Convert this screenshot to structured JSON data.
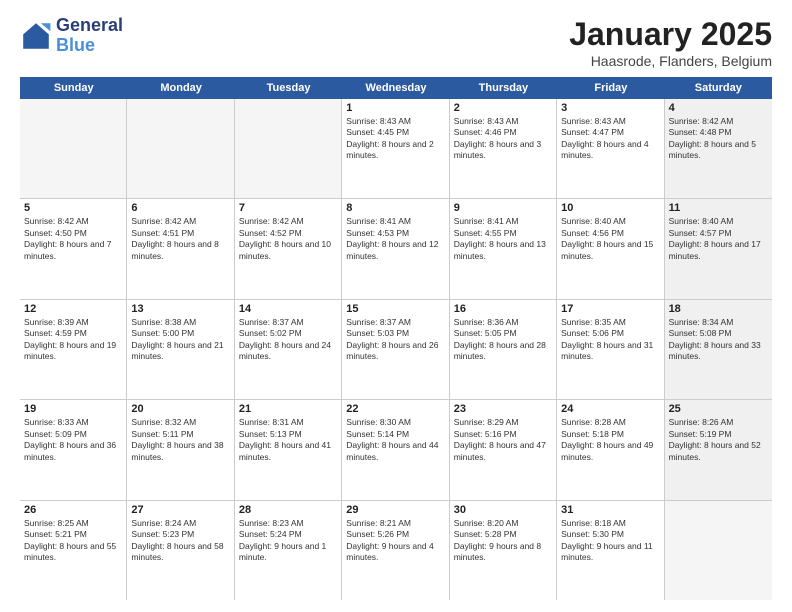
{
  "logo": {
    "line1": "General",
    "line2": "Blue"
  },
  "title": "January 2025",
  "subtitle": "Haasrode, Flanders, Belgium",
  "days": [
    "Sunday",
    "Monday",
    "Tuesday",
    "Wednesday",
    "Thursday",
    "Friday",
    "Saturday"
  ],
  "rows": [
    [
      {
        "day": "",
        "empty": true
      },
      {
        "day": "",
        "empty": true
      },
      {
        "day": "",
        "empty": true
      },
      {
        "day": "1",
        "rise": "8:43 AM",
        "set": "4:45 PM",
        "daylight": "8 hours and 2 minutes."
      },
      {
        "day": "2",
        "rise": "8:43 AM",
        "set": "4:46 PM",
        "daylight": "8 hours and 3 minutes."
      },
      {
        "day": "3",
        "rise": "8:43 AM",
        "set": "4:47 PM",
        "daylight": "8 hours and 4 minutes."
      },
      {
        "day": "4",
        "rise": "8:42 AM",
        "set": "4:48 PM",
        "daylight": "8 hours and 5 minutes.",
        "shaded": true
      }
    ],
    [
      {
        "day": "5",
        "rise": "8:42 AM",
        "set": "4:50 PM",
        "daylight": "8 hours and 7 minutes."
      },
      {
        "day": "6",
        "rise": "8:42 AM",
        "set": "4:51 PM",
        "daylight": "8 hours and 8 minutes."
      },
      {
        "day": "7",
        "rise": "8:42 AM",
        "set": "4:52 PM",
        "daylight": "8 hours and 10 minutes."
      },
      {
        "day": "8",
        "rise": "8:41 AM",
        "set": "4:53 PM",
        "daylight": "8 hours and 12 minutes."
      },
      {
        "day": "9",
        "rise": "8:41 AM",
        "set": "4:55 PM",
        "daylight": "8 hours and 13 minutes."
      },
      {
        "day": "10",
        "rise": "8:40 AM",
        "set": "4:56 PM",
        "daylight": "8 hours and 15 minutes."
      },
      {
        "day": "11",
        "rise": "8:40 AM",
        "set": "4:57 PM",
        "daylight": "8 hours and 17 minutes.",
        "shaded": true
      }
    ],
    [
      {
        "day": "12",
        "rise": "8:39 AM",
        "set": "4:59 PM",
        "daylight": "8 hours and 19 minutes."
      },
      {
        "day": "13",
        "rise": "8:38 AM",
        "set": "5:00 PM",
        "daylight": "8 hours and 21 minutes."
      },
      {
        "day": "14",
        "rise": "8:37 AM",
        "set": "5:02 PM",
        "daylight": "8 hours and 24 minutes."
      },
      {
        "day": "15",
        "rise": "8:37 AM",
        "set": "5:03 PM",
        "daylight": "8 hours and 26 minutes."
      },
      {
        "day": "16",
        "rise": "8:36 AM",
        "set": "5:05 PM",
        "daylight": "8 hours and 28 minutes."
      },
      {
        "day": "17",
        "rise": "8:35 AM",
        "set": "5:06 PM",
        "daylight": "8 hours and 31 minutes."
      },
      {
        "day": "18",
        "rise": "8:34 AM",
        "set": "5:08 PM",
        "daylight": "8 hours and 33 minutes.",
        "shaded": true
      }
    ],
    [
      {
        "day": "19",
        "rise": "8:33 AM",
        "set": "5:09 PM",
        "daylight": "8 hours and 36 minutes."
      },
      {
        "day": "20",
        "rise": "8:32 AM",
        "set": "5:11 PM",
        "daylight": "8 hours and 38 minutes."
      },
      {
        "day": "21",
        "rise": "8:31 AM",
        "set": "5:13 PM",
        "daylight": "8 hours and 41 minutes."
      },
      {
        "day": "22",
        "rise": "8:30 AM",
        "set": "5:14 PM",
        "daylight": "8 hours and 44 minutes."
      },
      {
        "day": "23",
        "rise": "8:29 AM",
        "set": "5:16 PM",
        "daylight": "8 hours and 47 minutes."
      },
      {
        "day": "24",
        "rise": "8:28 AM",
        "set": "5:18 PM",
        "daylight": "8 hours and 49 minutes."
      },
      {
        "day": "25",
        "rise": "8:26 AM",
        "set": "5:19 PM",
        "daylight": "8 hours and 52 minutes.",
        "shaded": true
      }
    ],
    [
      {
        "day": "26",
        "rise": "8:25 AM",
        "set": "5:21 PM",
        "daylight": "8 hours and 55 minutes."
      },
      {
        "day": "27",
        "rise": "8:24 AM",
        "set": "5:23 PM",
        "daylight": "8 hours and 58 minutes."
      },
      {
        "day": "28",
        "rise": "8:23 AM",
        "set": "5:24 PM",
        "daylight": "9 hours and 1 minute."
      },
      {
        "day": "29",
        "rise": "8:21 AM",
        "set": "5:26 PM",
        "daylight": "9 hours and 4 minutes."
      },
      {
        "day": "30",
        "rise": "8:20 AM",
        "set": "5:28 PM",
        "daylight": "9 hours and 8 minutes."
      },
      {
        "day": "31",
        "rise": "8:18 AM",
        "set": "5:30 PM",
        "daylight": "9 hours and 11 minutes."
      },
      {
        "day": "",
        "empty": true,
        "shaded": true
      }
    ]
  ]
}
